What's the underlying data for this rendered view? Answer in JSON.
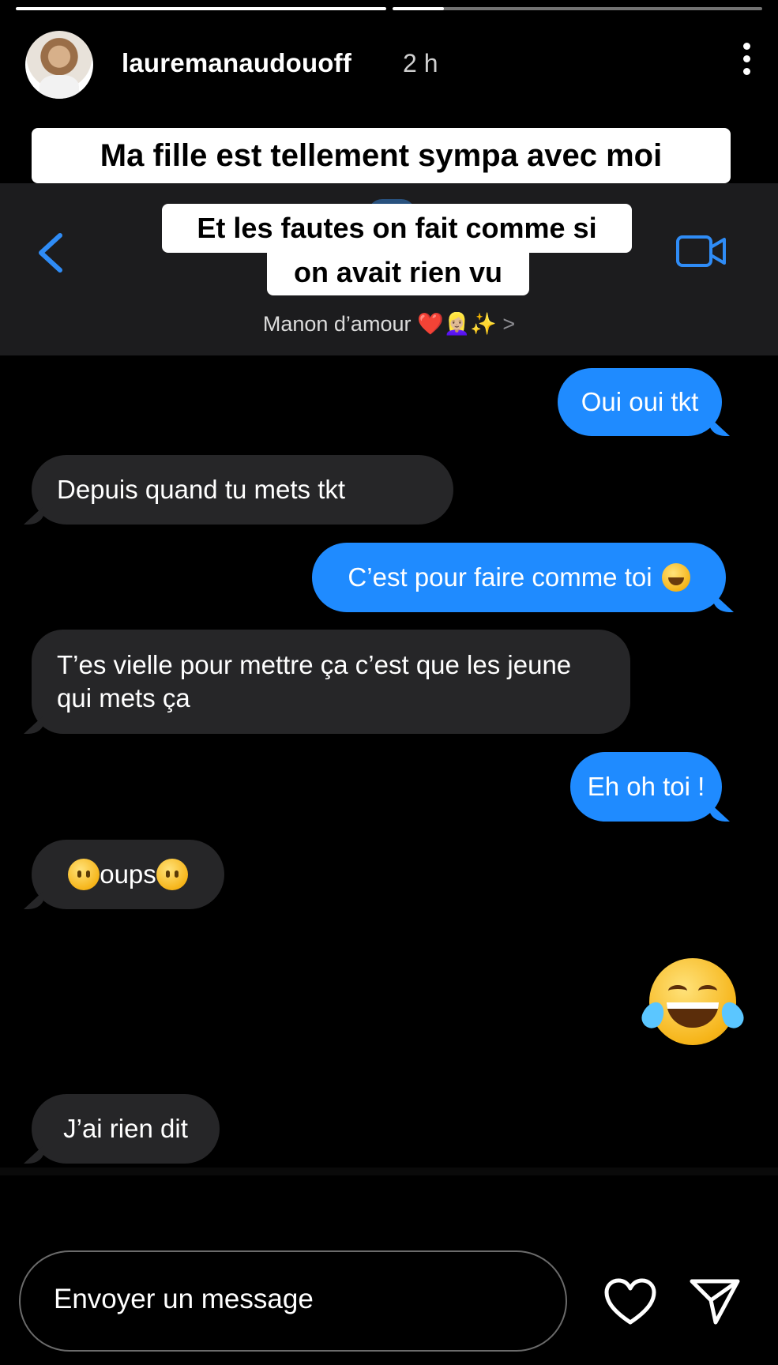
{
  "story": {
    "username": "lauremanaudouoff",
    "time": "2 h",
    "progress": [
      1.0,
      0.14
    ]
  },
  "captions": [
    "Ma fille est tellement sympa avec moi",
    "Et les fautes on fait comme si",
    "on avait rien vu"
  ],
  "chat": {
    "contact_name": "Manon d’amour ❤️👱🏼‍♀️✨",
    "chevron": ">",
    "messages": [
      {
        "dir": "out",
        "text": "Oui oui tkt"
      },
      {
        "dir": "in",
        "text": "Depuis quand tu mets tkt"
      },
      {
        "dir": "out",
        "text": "C’est pour faire comme toi"
      },
      {
        "dir": "in",
        "text": "T’es vielle pour mettre ça c’est que les jeune qui mets ça"
      },
      {
        "dir": "out",
        "text": "Eh oh toi !"
      },
      {
        "dir": "in",
        "text": "oups"
      },
      {
        "dir": "out",
        "emoji": "face-with-tears-of-joy"
      },
      {
        "dir": "in",
        "text": "J’ai rien dit"
      }
    ]
  },
  "reply": {
    "placeholder": "Envoyer un message"
  },
  "colors": {
    "outgoing_bubble": "#1f8bff",
    "incoming_bubble": "#262628",
    "ios_blue": "#2f8cf6"
  },
  "icons": [
    "back-chevron-icon",
    "video-camera-icon",
    "more-options-icon",
    "heart-icon",
    "send-icon"
  ]
}
